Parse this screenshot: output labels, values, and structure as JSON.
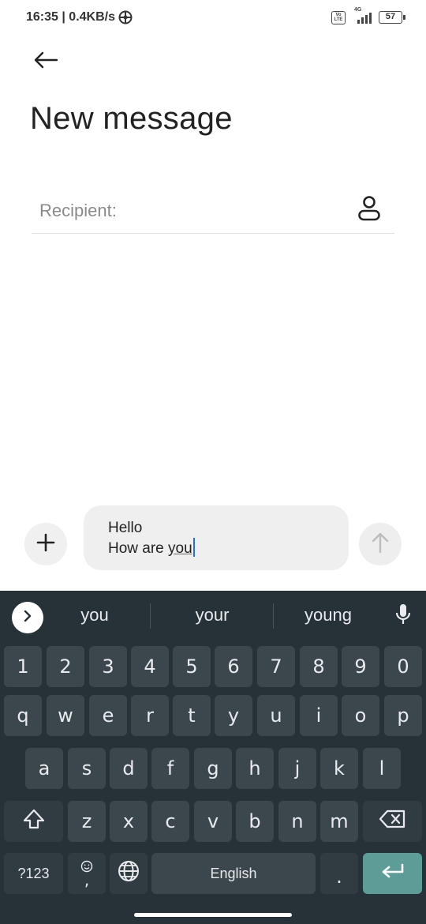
{
  "status_bar": {
    "time_speed": "16:35 | 0.4KB/s",
    "network": "4G",
    "volte_top": "Vo",
    "volte_bottom": "LTE",
    "battery": "57"
  },
  "header": {
    "title": "New message"
  },
  "recipient": {
    "placeholder": "Recipient:"
  },
  "compose": {
    "line1": "Hello",
    "line2_prefix": "How are ",
    "line2_underlined": "you"
  },
  "keyboard": {
    "suggestions": [
      "you",
      "your",
      "young"
    ],
    "row_numbers": [
      "1",
      "2",
      "3",
      "4",
      "5",
      "6",
      "7",
      "8",
      "9",
      "0"
    ],
    "row_1": [
      "q",
      "w",
      "e",
      "r",
      "t",
      "y",
      "u",
      "i",
      "o",
      "p"
    ],
    "row_2": [
      "a",
      "s",
      "d",
      "f",
      "g",
      "h",
      "j",
      "k",
      "l"
    ],
    "row_3": [
      "z",
      "x",
      "c",
      "v",
      "b",
      "n",
      "m"
    ],
    "symbols_label": "?123",
    "comma_label": ",",
    "space_label": "English",
    "period_label": "."
  },
  "colors": {
    "keyboard_bg": "#263238",
    "key_bg": "#3c474d",
    "enter_key": "#5c9e97",
    "caret": "#1a73e8"
  },
  "icons": {
    "back": "arrow-left-icon",
    "contact": "contact-person-icon",
    "attach": "plus-icon",
    "send": "arrow-up-icon",
    "expand": "chevron-right-icon",
    "mic": "microphone-icon",
    "shift": "shift-arrow-icon",
    "backspace": "backspace-icon",
    "emoji": "emoji-icon",
    "globe": "globe-icon",
    "enter": "enter-return-icon"
  }
}
